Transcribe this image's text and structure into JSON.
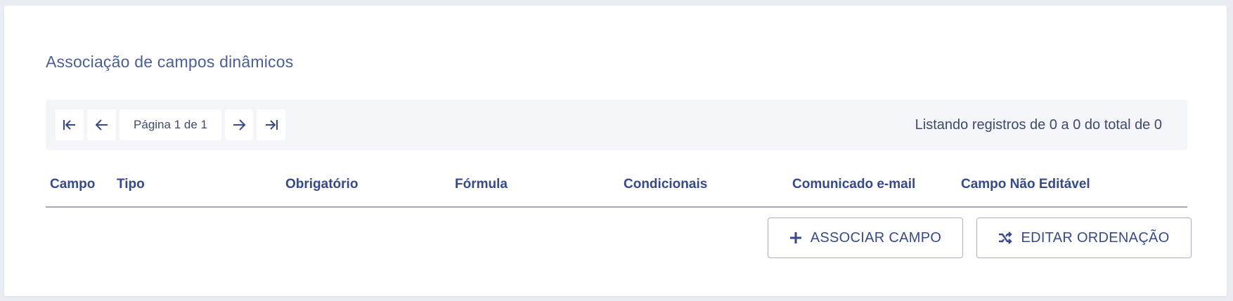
{
  "card": {
    "title": "Associação de campos dinâmicos"
  },
  "pagination": {
    "first_icon": "first-page-icon",
    "prev_icon": "arrow-left-icon",
    "page_label": "Página 1 de 1",
    "next_icon": "arrow-right-icon",
    "last_icon": "last-page-icon",
    "listing_text": "Listando registros de 0 a 0 do total de 0"
  },
  "table": {
    "columns": [
      "Campo",
      "Tipo",
      "Obrigatório",
      "Fórmula",
      "Condicionais",
      "Comunicado e-mail",
      "Campo Não Editável"
    ],
    "rows": []
  },
  "actions": {
    "associate_label": "ASSOCIAR CAMPO",
    "associate_icon": "plus-icon",
    "reorder_label": "EDITAR ORDENAÇÃO",
    "reorder_icon": "shuffle-icon"
  },
  "colors": {
    "accent": "#34498f",
    "toolbar_bg": "#f4f5f9",
    "page_bg": "#e9ecf2"
  }
}
